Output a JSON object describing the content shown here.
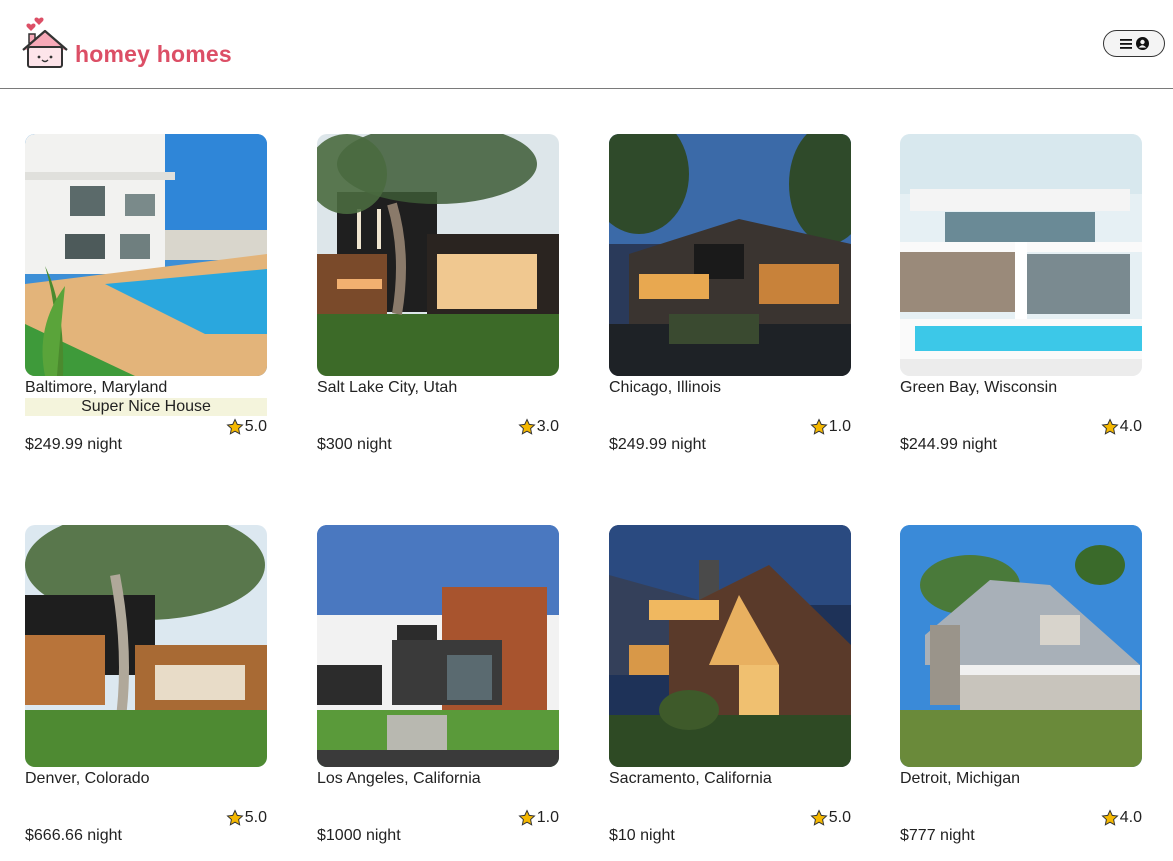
{
  "app": {
    "brand": "homey homes"
  },
  "header": {
    "menu_icon": "hamburger-icon",
    "account_icon": "user-circle-icon"
  },
  "listings": [
    {
      "location": "Baltimore, Maryland",
      "badge": "Super Nice House",
      "rating": "5.0",
      "price": "$249.99 night"
    },
    {
      "location": "Salt Lake City, Utah",
      "badge": "",
      "rating": "3.0",
      "price": "$300 night"
    },
    {
      "location": "Chicago, Illinois",
      "badge": "",
      "rating": "1.0",
      "price": "$249.99 night"
    },
    {
      "location": "Green Bay, Wisconsin",
      "badge": "",
      "rating": "4.0",
      "price": "$244.99 night"
    },
    {
      "location": "Denver, Colorado",
      "badge": "",
      "rating": "5.0",
      "price": "$666.66 night"
    },
    {
      "location": "Los Angeles, California",
      "badge": "",
      "rating": "1.0",
      "price": "$1000 night"
    },
    {
      "location": "Sacramento, California",
      "badge": "",
      "rating": "5.0",
      "price": "$10 night"
    },
    {
      "location": "Detroit, Michigan",
      "badge": "",
      "rating": "4.0",
      "price": "$777 night"
    }
  ],
  "colors": {
    "brand": "#dc4f66",
    "star": "#f5b800",
    "badge_bg": "#f4f4dc"
  }
}
